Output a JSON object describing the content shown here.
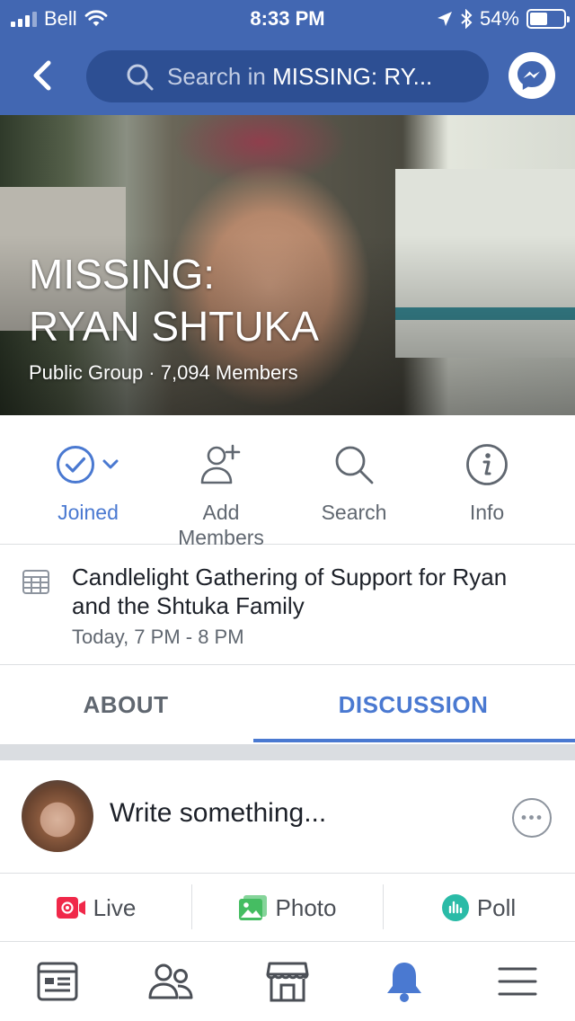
{
  "status_bar": {
    "carrier": "Bell",
    "time": "8:33 PM",
    "battery_percent": "54%",
    "battery_level": 0.54
  },
  "nav": {
    "search_placeholder": "Search in",
    "search_scope": "MISSING: RY...",
    "back_icon": "chevron-left-icon",
    "messenger_icon": "messenger-icon"
  },
  "group": {
    "title_line1": "MISSING:",
    "title_line2": "RYAN SHTUKA",
    "meta": "Public Group · 7,094 Members"
  },
  "actions": [
    {
      "label": "Joined",
      "icon": "check-circle-icon"
    },
    {
      "label_line1": "Add",
      "label_line2": "Members",
      "icon": "add-person-icon"
    },
    {
      "label": "Search",
      "icon": "search-icon"
    },
    {
      "label": "Info",
      "icon": "info-icon"
    }
  ],
  "event": {
    "title": "Candlelight Gathering of Support for Ryan and the Shtuka Family",
    "time": "Today, 7 PM - 8 PM",
    "icon": "calendar-icon"
  },
  "tabs": [
    {
      "label": "ABOUT",
      "active": false
    },
    {
      "label": "DISCUSSION",
      "active": true
    }
  ],
  "composer": {
    "placeholder": "Write something..."
  },
  "post_types": [
    {
      "label": "Live",
      "icon": "live-video-icon",
      "color": "#f02849"
    },
    {
      "label": "Photo",
      "icon": "photo-icon",
      "color": "#45bd62"
    },
    {
      "label": "Poll",
      "icon": "poll-icon",
      "color": "#2abba7"
    }
  ],
  "bottom_nav": [
    "news-feed-icon",
    "groups-icon",
    "marketplace-icon",
    "notifications-icon",
    "menu-icon"
  ],
  "colors": {
    "brand": "#4267b2",
    "accent": "#4a79d1"
  }
}
